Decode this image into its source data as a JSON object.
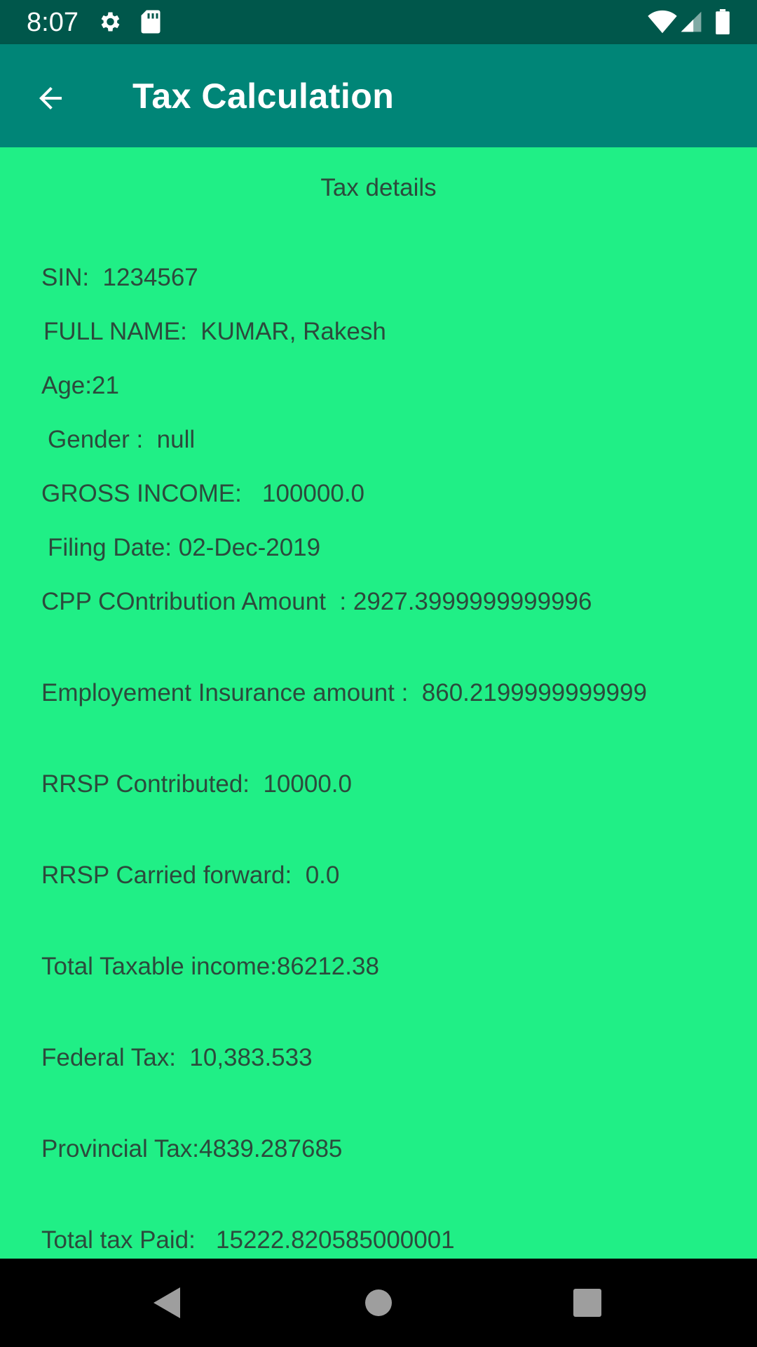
{
  "status_bar": {
    "time": "8:07",
    "icons": [
      "gear-icon",
      "sd-card-icon",
      "wifi-icon",
      "signal-icon",
      "battery-icon"
    ]
  },
  "app_bar": {
    "back_icon": "arrow-left-icon",
    "title": "Tax Calculation"
  },
  "content": {
    "section_title": "Tax details",
    "sin": "SIN:  1234567",
    "full_name": "FULL NAME:  KUMAR, Rakesh",
    "age": "Age:21",
    "gender": "Gender :  null",
    "gross_income": "GROSS INCOME:   100000.0",
    "filing_date": "Filing Date: 02-Dec-2019",
    "cpp": "CPP COntribution Amount  : 2927.3999999999996",
    "ei": "Employement Insurance amount :  860.2199999999999",
    "rrsp_contributed": "RRSP Contributed:  10000.0",
    "rrsp_carried": "RRSP Carried forward:  0.0",
    "total_taxable": "Total Taxable income:86212.38",
    "federal_tax": "Federal Tax:  10,383.533",
    "provincial_tax": "Provincial Tax:4839.287685",
    "total_tax_paid": "Total tax Paid:   15222.820585000001"
  },
  "nav_bar": {
    "icons": [
      "nav-back-icon",
      "nav-home-icon",
      "nav-recents-icon"
    ]
  },
  "colors": {
    "status_bar": "#00574b",
    "app_bar": "#008577",
    "background": "#20ef86",
    "text": "#2c4a3c"
  }
}
